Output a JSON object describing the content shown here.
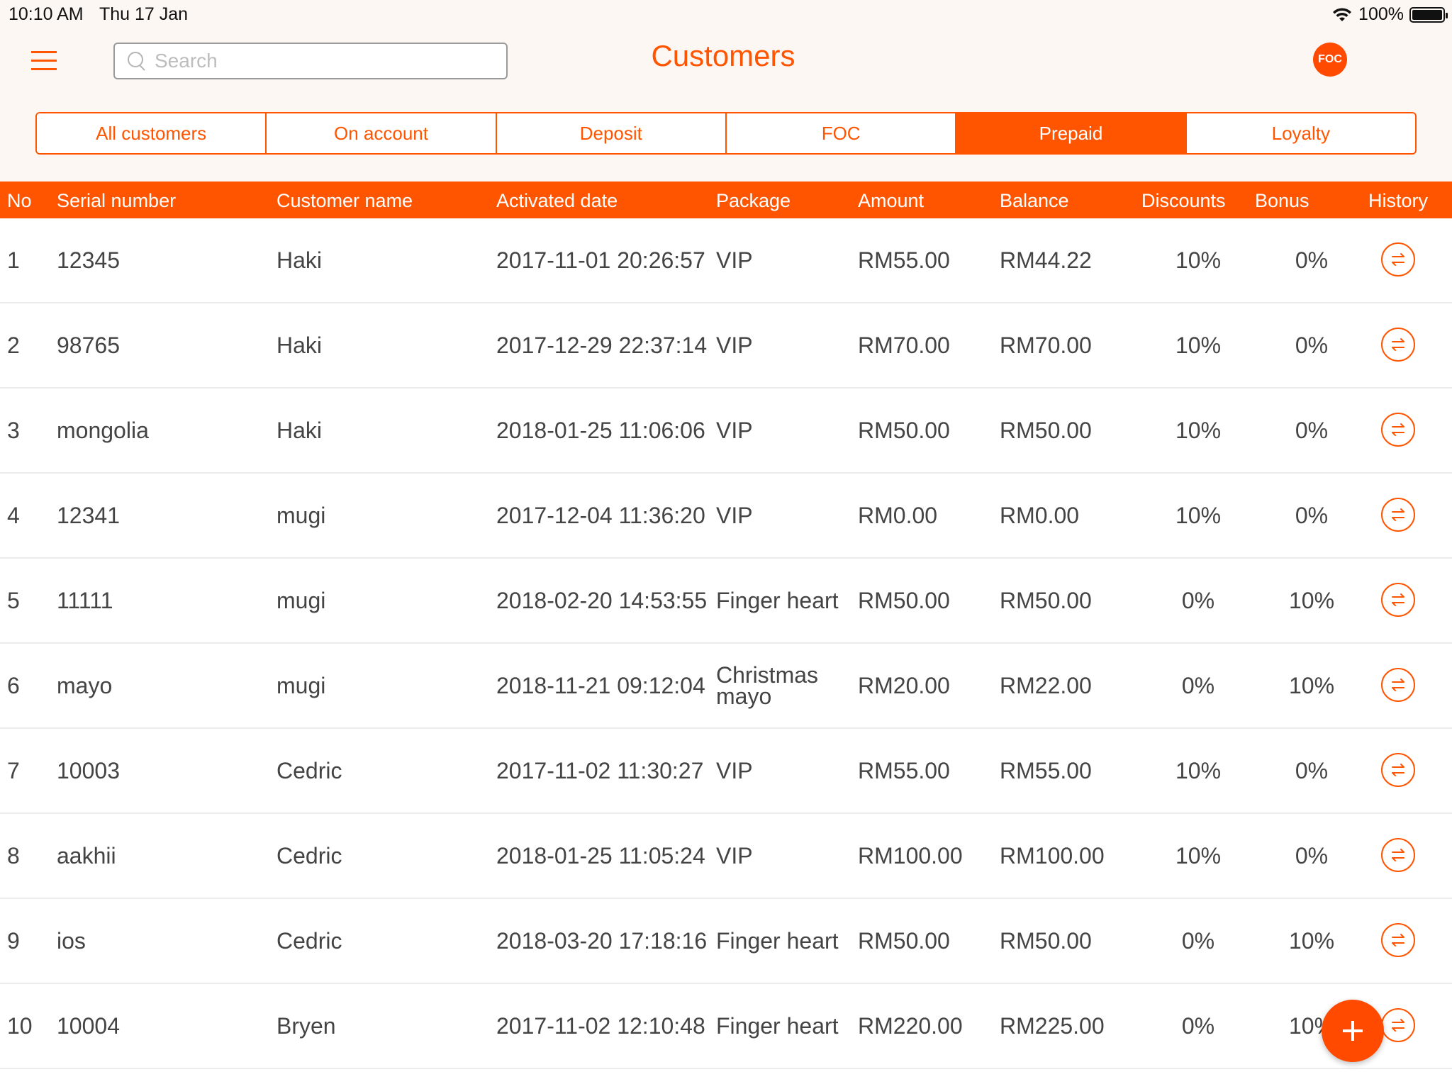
{
  "status_bar": {
    "time": "10:10 AM",
    "date": "Thu 17 Jan",
    "battery": "100%",
    "battery_level": 1.0
  },
  "header": {
    "title": "Customers",
    "search_placeholder": "Search",
    "badge": "FOC"
  },
  "tabs": [
    {
      "label": "All customers",
      "active": false
    },
    {
      "label": "On account",
      "active": false
    },
    {
      "label": "Deposit",
      "active": false
    },
    {
      "label": "FOC",
      "active": false
    },
    {
      "label": "Prepaid",
      "active": true
    },
    {
      "label": "Loyalty",
      "active": false
    }
  ],
  "columns": {
    "no": "No",
    "serial": "Serial number",
    "customer": "Customer name",
    "activated": "Activated date",
    "package": "Package",
    "amount": "Amount",
    "balance": "Balance",
    "discounts": "Discounts",
    "bonus": "Bonus",
    "history": "History"
  },
  "rows": [
    {
      "no": "1",
      "serial": "12345",
      "customer": "Haki",
      "activated": "2017-11-01 20:26:57",
      "package": "VIP",
      "amount": "RM55.00",
      "balance": "RM44.22",
      "discounts": "10%",
      "bonus": "0%"
    },
    {
      "no": "2",
      "serial": "98765",
      "customer": "Haki",
      "activated": "2017-12-29 22:37:14",
      "package": "VIP",
      "amount": "RM70.00",
      "balance": "RM70.00",
      "discounts": "10%",
      "bonus": "0%"
    },
    {
      "no": "3",
      "serial": "mongolia",
      "customer": "Haki",
      "activated": "2018-01-25 11:06:06",
      "package": "VIP",
      "amount": "RM50.00",
      "balance": "RM50.00",
      "discounts": "10%",
      "bonus": "0%"
    },
    {
      "no": "4",
      "serial": "12341",
      "customer": "mugi",
      "activated": "2017-12-04 11:36:20",
      "package": "VIP",
      "amount": "RM0.00",
      "balance": "RM0.00",
      "discounts": "10%",
      "bonus": "0%"
    },
    {
      "no": "5",
      "serial": "11111",
      "customer": "mugi",
      "activated": "2018-02-20 14:53:55",
      "package": "Finger heart",
      "amount": "RM50.00",
      "balance": "RM50.00",
      "discounts": "0%",
      "bonus": "10%"
    },
    {
      "no": "6",
      "serial": "mayo",
      "customer": "mugi",
      "activated": "2018-11-21 09:12:04",
      "package": "Christmas mayo",
      "amount": "RM20.00",
      "balance": "RM22.00",
      "discounts": "0%",
      "bonus": "10%"
    },
    {
      "no": "7",
      "serial": "10003",
      "customer": "Cedric",
      "activated": "2017-11-02 11:30:27",
      "package": "VIP",
      "amount": "RM55.00",
      "balance": "RM55.00",
      "discounts": "10%",
      "bonus": "0%"
    },
    {
      "no": "8",
      "serial": "aakhii",
      "customer": "Cedric",
      "activated": "2018-01-25 11:05:24",
      "package": "VIP",
      "amount": "RM100.00",
      "balance": "RM100.00",
      "discounts": "10%",
      "bonus": "0%"
    },
    {
      "no": "9",
      "serial": "ios",
      "customer": "Cedric",
      "activated": "2018-03-20 17:18:16",
      "package": "Finger heart",
      "amount": "RM50.00",
      "balance": "RM50.00",
      "discounts": "0%",
      "bonus": "10%"
    },
    {
      "no": "10",
      "serial": "10004",
      "customer": "Bryen",
      "activated": "2017-11-02 12:10:48",
      "package": "Finger heart",
      "amount": "RM220.00",
      "balance": "RM225.00",
      "discounts": "0%",
      "bonus": "10%"
    }
  ],
  "colors": {
    "accent": "#ff5500",
    "header_bg": "#fdf7f3",
    "row_border": "#ececec"
  },
  "icons": {
    "history": "history-swap-icon",
    "menu": "hamburger-menu-icon",
    "search": "search-icon",
    "add": "plus-icon"
  }
}
